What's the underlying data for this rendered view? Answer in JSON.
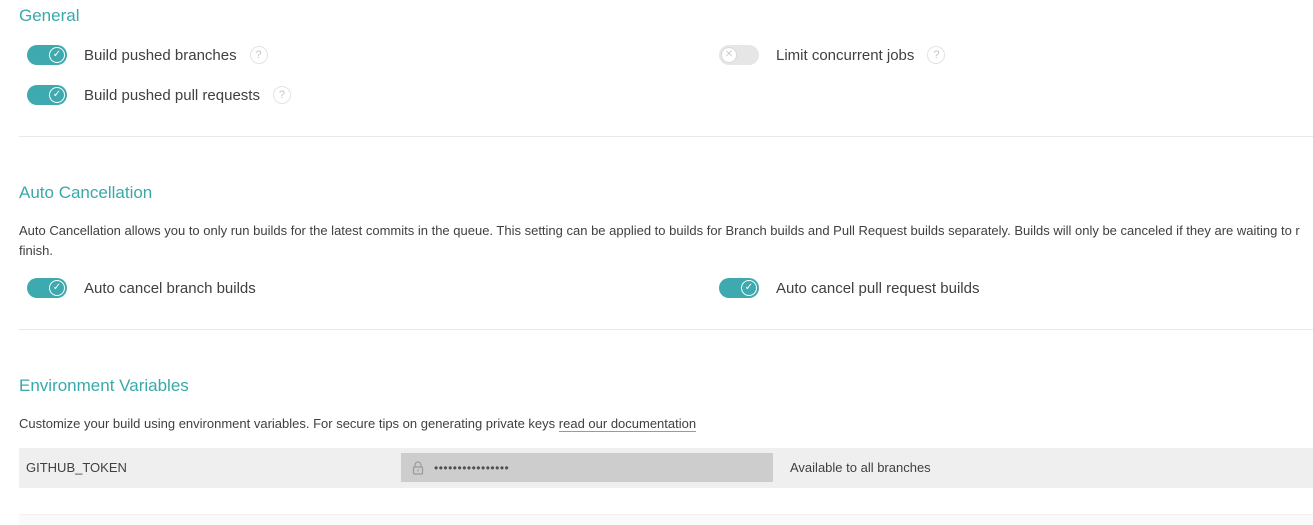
{
  "general": {
    "title": "General",
    "build_pushed_branches": {
      "label": "Build pushed branches",
      "enabled": true,
      "help": "?"
    },
    "build_pushed_pull_requests": {
      "label": "Build pushed pull requests",
      "enabled": true,
      "help": "?"
    },
    "limit_concurrent_jobs": {
      "label": "Limit concurrent jobs",
      "enabled": false,
      "help": "?"
    }
  },
  "auto_cancellation": {
    "title": "Auto Cancellation",
    "description": "Auto Cancellation allows you to only run builds for the latest commits in the queue. This setting can be applied to builds for Branch builds and Pull Request builds separately. Builds will only be canceled if they are waiting to r finish.",
    "branch_builds": {
      "label": "Auto cancel branch builds",
      "enabled": true
    },
    "pull_request_builds": {
      "label": "Auto cancel pull request builds",
      "enabled": true
    }
  },
  "env_vars": {
    "title": "Environment Variables",
    "description": "Customize your build using environment variables. For secure tips on generating private keys",
    "doc_link": "read our documentation",
    "variables": [
      {
        "name": "GITHUB_TOKEN",
        "value": "••••••••••••••••",
        "branches": "Available to all branches"
      }
    ]
  },
  "icons": {
    "toggle_on": "check-icon",
    "toggle_off": "x-icon",
    "help": "question-icon",
    "secure_value": "lock-icon"
  },
  "colors": {
    "accent": "#39a9a9",
    "toggle_on": "#3eaaaf",
    "toggle_off": "#e6e6e6",
    "env_row_bg": "#efefef",
    "env_value_bg": "#cdcdcd"
  }
}
